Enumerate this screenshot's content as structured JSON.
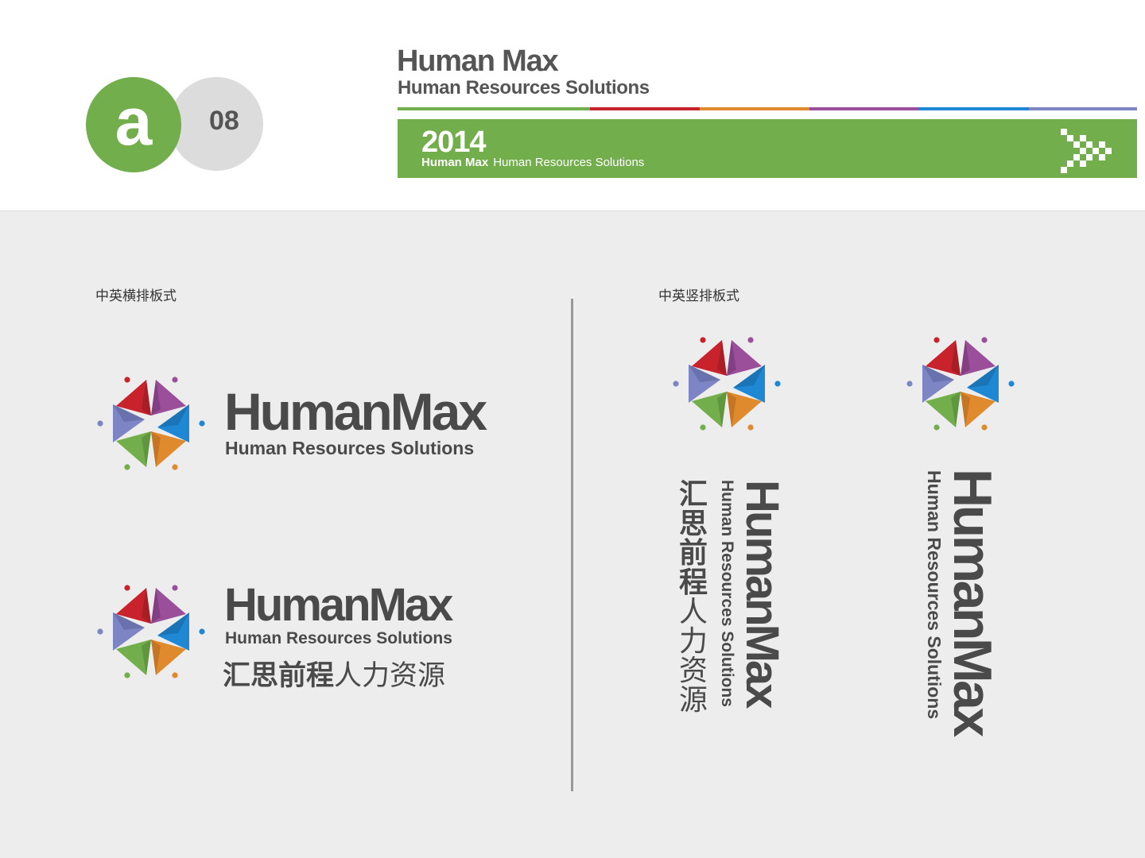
{
  "header": {
    "badge_letter": "a",
    "page_number": "08",
    "brand_title": "Human Max",
    "brand_subtitle": "Human Resources Solutions",
    "banner_year": "2014",
    "banner_brand": "Human Max",
    "banner_tagline": "Human Resources Solutions",
    "stripe_colors": [
      "#72ae4c",
      "#c8232c",
      "#e08a2e",
      "#9b4f9b",
      "#1e88d4",
      "#7d85c4"
    ],
    "banner_color": "#72ae4c"
  },
  "sections": {
    "horizontal_label": "中英横排板式",
    "vertical_label": "中英竖排板式"
  },
  "logo": {
    "name": "HumanMax",
    "tagline": "Human Resources Solutions",
    "cn_bold": "汇思前程",
    "cn_light": "人力资源",
    "colors": {
      "red": "#c8232c",
      "purple": "#9b4f9b",
      "blue": "#1e88d4",
      "orange": "#e08a2e",
      "green": "#72ae4c",
      "lavender": "#7d85c4"
    }
  }
}
